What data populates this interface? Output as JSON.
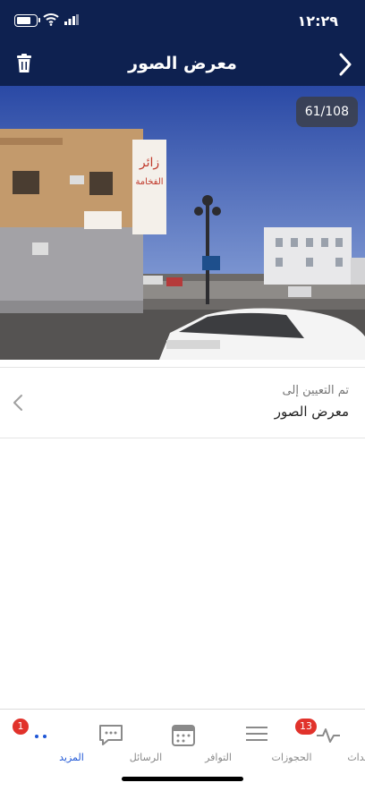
{
  "status_bar": {
    "time": "١٢:٢٩"
  },
  "header": {
    "title": "معرض الصور"
  },
  "photo": {
    "counter": "61/108"
  },
  "assignment": {
    "label": "تم التعيين إلى",
    "value": "معرض الصور"
  },
  "tabs": [
    {
      "label": "الأحداث",
      "icon": "activity-icon",
      "badge": "13"
    },
    {
      "label": "الحجوزات",
      "icon": "list-icon"
    },
    {
      "label": "التوافر",
      "icon": "calendar-icon"
    },
    {
      "label": "الرسائل",
      "icon": "chat-icon"
    },
    {
      "label": "المزيد",
      "icon": "more-icon",
      "badge": "1",
      "active": true
    }
  ],
  "colors": {
    "header": "#0e2150",
    "accent": "#1f57d6",
    "badge": "#e1322b"
  }
}
